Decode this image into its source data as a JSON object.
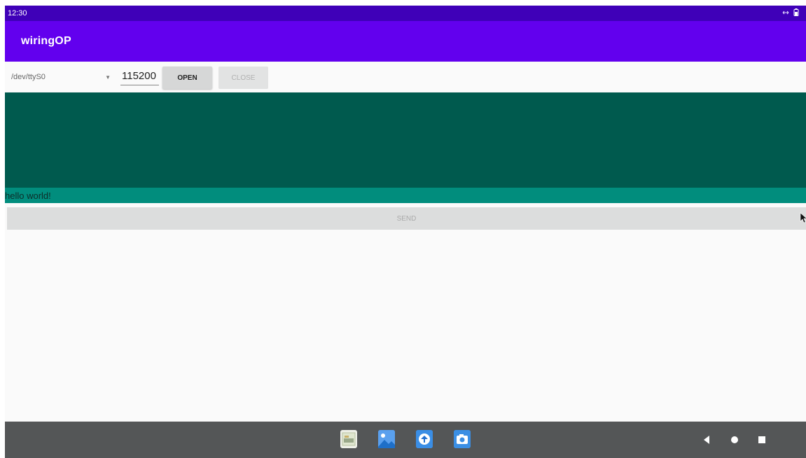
{
  "status_bar": {
    "time": "12:30",
    "icons": [
      "sync-arrows-icon",
      "battery-icon"
    ]
  },
  "app_bar": {
    "title": "wiringOP"
  },
  "controls": {
    "port_selected": "/dev/ttyS0",
    "baud_value": "115200",
    "open_label": "OPEN",
    "close_label": "CLOSE"
  },
  "message": {
    "text": "hello world!"
  },
  "send": {
    "label": "SEND"
  },
  "dock": {
    "apps": [
      "gallery-thumbnail-icon",
      "photos-icon",
      "browser-icon",
      "camera-icon"
    ]
  },
  "nav": {
    "buttons": [
      "back-icon",
      "home-icon",
      "recents-icon"
    ]
  },
  "colors": {
    "status_bar": "#3f00b8",
    "app_bar": "#6200ee",
    "receive_area": "#005a4e",
    "message_bar": "#018d7d",
    "nav_bar": "#545657"
  }
}
